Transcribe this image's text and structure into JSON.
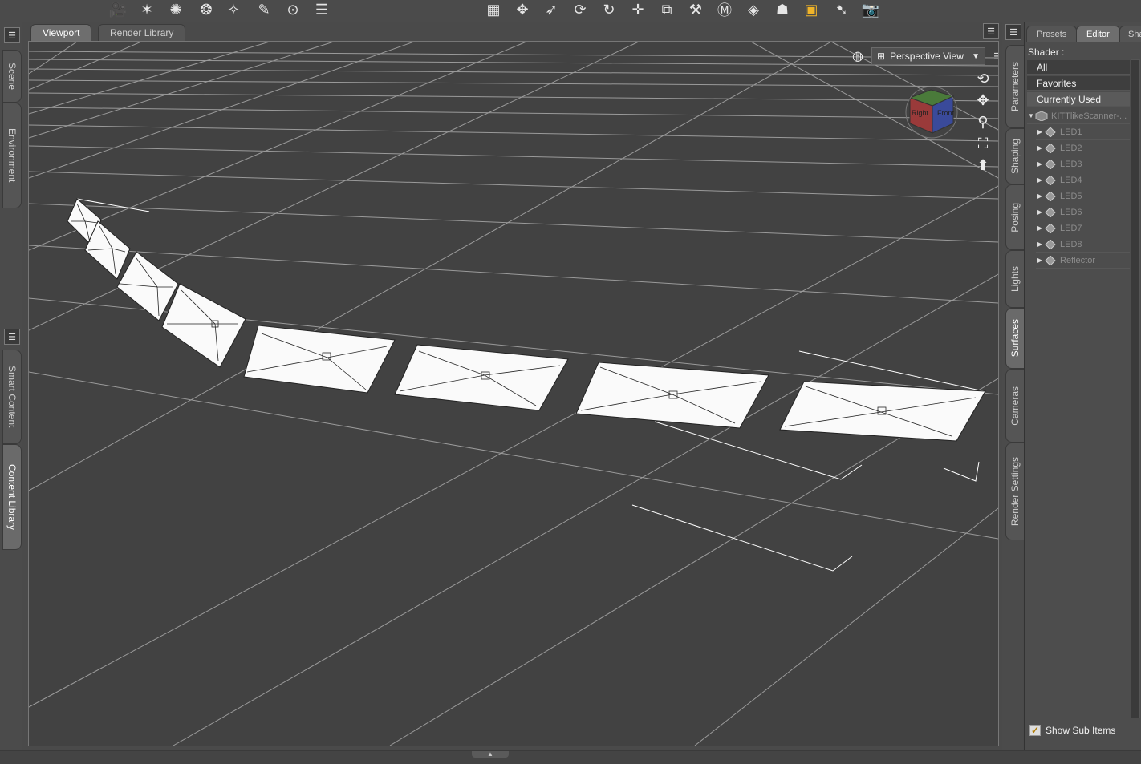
{
  "toolbar": {
    "icons": [
      "camera-icon",
      "light-spot-icon",
      "light-point-icon",
      "light-distant-icon",
      "light-brush-icon",
      "paint-brush-icon",
      "node-select-icon",
      "align-icon",
      "render-grid-icon",
      "orbit-icon",
      "select-arrow-icon",
      "rotate-icon",
      "spin-icon",
      "translate-icon",
      "scale-icon",
      "bone-icon",
      "morph-icon",
      "eraser-icon",
      "figure-icon",
      "spot-render-icon",
      "pointer-icon",
      "render-camera-icon"
    ]
  },
  "left_tabs": [
    "Scene",
    "Environment",
    "Smart Content",
    "Content Library"
  ],
  "viewport_tabs": [
    "Viewport",
    "Render Library"
  ],
  "viewport": {
    "view_mode": "Perspective View",
    "cube_faces": {
      "right": "Right",
      "front": "Front"
    }
  },
  "right_tabs": [
    "Parameters",
    "Shaping",
    "Posing",
    "Lights",
    "Surfaces",
    "Cameras",
    "Render Settings"
  ],
  "panel": {
    "tabs": [
      "Presets",
      "Editor",
      "Sha"
    ],
    "shader_label": "Shader :",
    "shader_items": [
      "All",
      "Favorites",
      "Currently Used"
    ],
    "root_item": "KITTlikeScanner-...",
    "children": [
      "LED1",
      "LED2",
      "LED3",
      "LED4",
      "LED5",
      "LED6",
      "LED7",
      "LED8",
      "Reflector"
    ],
    "show_sub_items": "Show Sub Items",
    "show_sub_items_checked": true
  },
  "colors": {
    "background": "#4a4a4a",
    "viewport": "#424242",
    "accent": "#f0b429"
  }
}
